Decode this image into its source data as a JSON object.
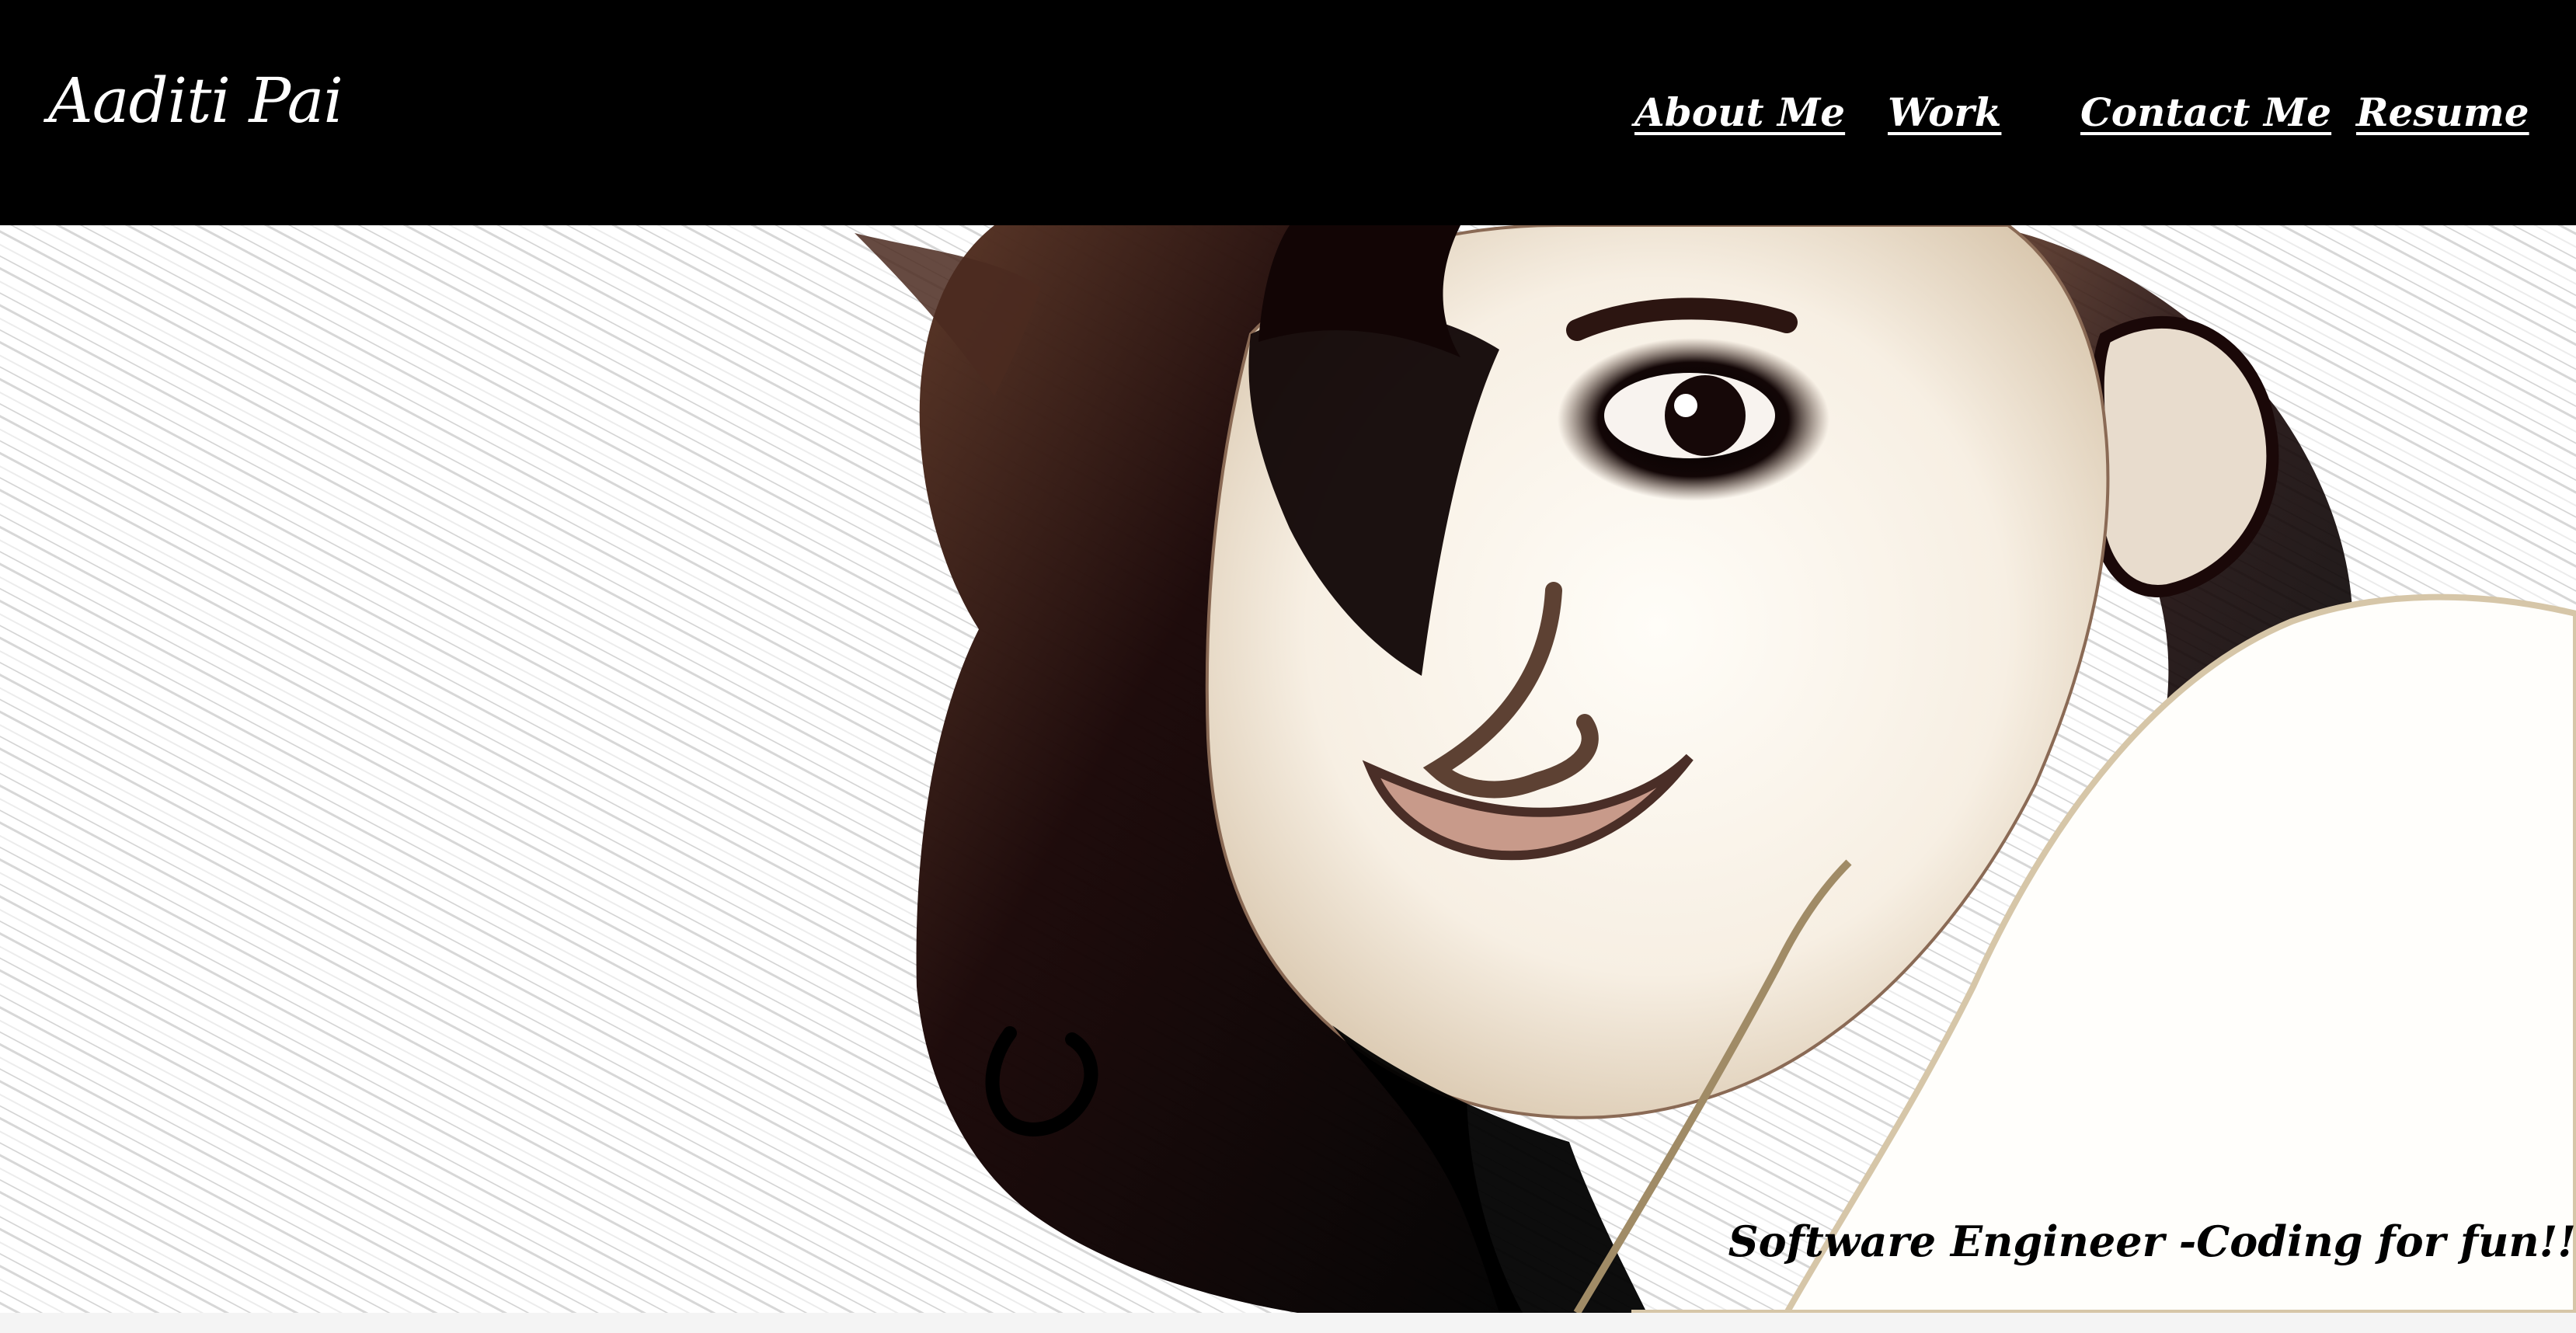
{
  "header": {
    "brand": "Aaditi Pai",
    "nav": [
      {
        "label": "About Me"
      },
      {
        "label": "Work"
      },
      {
        "label": "Contact Me"
      },
      {
        "label": "Resume"
      }
    ]
  },
  "hero": {
    "tagline": "Software Engineer -Coding for fun!!",
    "photo_icon": "portrait-sketch-image"
  },
  "colors": {
    "header_bg": "#000000",
    "header_text": "#ffffff",
    "page_bg": "#ffffff",
    "tagline_text": "#000000"
  }
}
